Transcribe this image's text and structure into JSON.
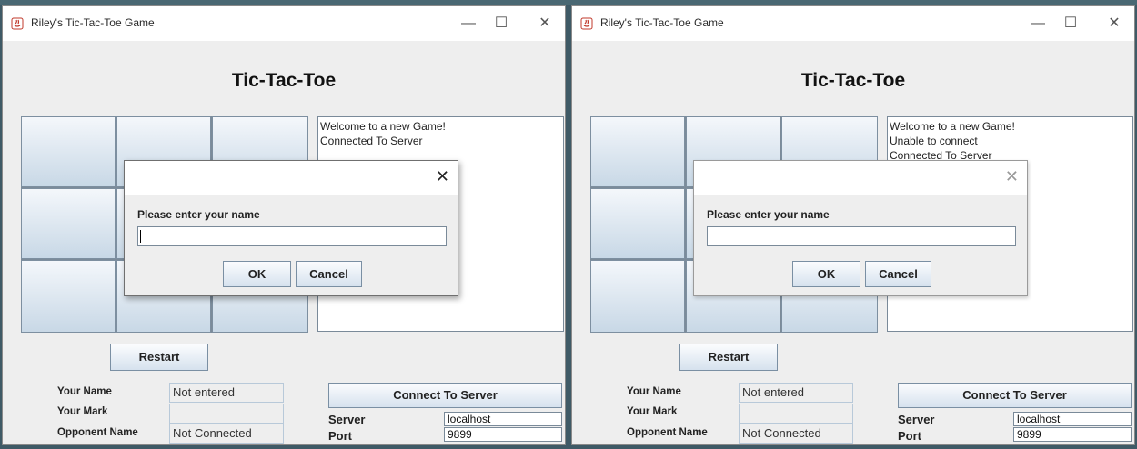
{
  "windows": [
    {
      "title": "Riley's Tic-Tac-Toe Game",
      "heading": "Tic-Tac-Toe",
      "log_lines": [
        "Welcome to a new Game!",
        "Connected To Server"
      ],
      "restart_label": "Restart",
      "labels": {
        "your_name": "Your Name",
        "your_mark": "Your Mark",
        "opponent_name": "Opponent Name"
      },
      "values": {
        "your_name": "Not entered",
        "your_mark": "",
        "opponent_name": "Not Connected"
      },
      "connect_label": "Connect To Server",
      "server_label": "Server",
      "server_value": "localhost",
      "port_label": "Port",
      "port_value": "9899",
      "dialog": {
        "prompt": "Please enter your name",
        "ok": "OK",
        "cancel": "Cancel",
        "active": true
      }
    },
    {
      "title": "Riley's Tic-Tac-Toe Game",
      "heading": "Tic-Tac-Toe",
      "log_lines": [
        "Welcome to a new Game!",
        "Unable to connect",
        "Connected To Server"
      ],
      "restart_label": "Restart",
      "labels": {
        "your_name": "Your Name",
        "your_mark": "Your Mark",
        "opponent_name": "Opponent Name"
      },
      "values": {
        "your_name": "Not entered",
        "your_mark": "",
        "opponent_name": "Not Connected"
      },
      "connect_label": "Connect To Server",
      "server_label": "Server",
      "server_value": "localhost",
      "port_label": "Port",
      "port_value": "9899",
      "dialog": {
        "prompt": "Please enter your name",
        "ok": "OK",
        "cancel": "Cancel",
        "active": false
      }
    }
  ],
  "window_controls": {
    "minimize": "—",
    "maximize": "☐",
    "close": "✕"
  },
  "dialog_close_glyph": "✕",
  "colors": {
    "board_cell_top": "#f4f7fb",
    "board_cell_bottom": "#c8d8e6",
    "window_bg": "#eeeeee"
  }
}
